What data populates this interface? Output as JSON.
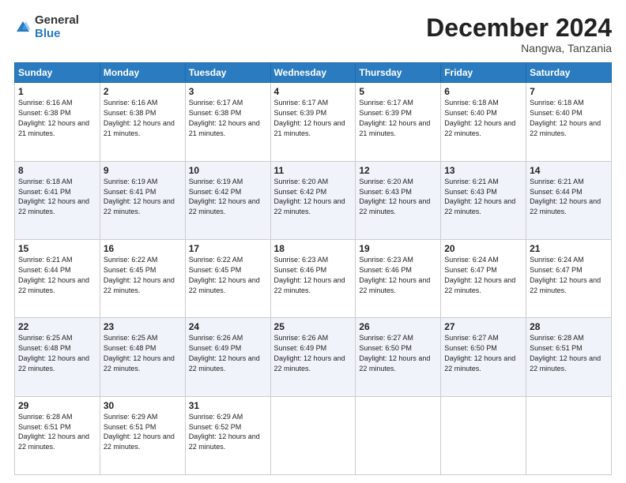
{
  "logo": {
    "general": "General",
    "blue": "Blue"
  },
  "title": "December 2024",
  "subtitle": "Nangwa, Tanzania",
  "days_header": [
    "Sunday",
    "Monday",
    "Tuesday",
    "Wednesday",
    "Thursday",
    "Friday",
    "Saturday"
  ],
  "weeks": [
    [
      {
        "day": "1",
        "sunrise": "6:16 AM",
        "sunset": "6:38 PM",
        "daylight": "12 hours and 21 minutes."
      },
      {
        "day": "2",
        "sunrise": "6:16 AM",
        "sunset": "6:38 PM",
        "daylight": "12 hours and 21 minutes."
      },
      {
        "day": "3",
        "sunrise": "6:17 AM",
        "sunset": "6:38 PM",
        "daylight": "12 hours and 21 minutes."
      },
      {
        "day": "4",
        "sunrise": "6:17 AM",
        "sunset": "6:39 PM",
        "daylight": "12 hours and 21 minutes."
      },
      {
        "day": "5",
        "sunrise": "6:17 AM",
        "sunset": "6:39 PM",
        "daylight": "12 hours and 21 minutes."
      },
      {
        "day": "6",
        "sunrise": "6:18 AM",
        "sunset": "6:40 PM",
        "daylight": "12 hours and 22 minutes."
      },
      {
        "day": "7",
        "sunrise": "6:18 AM",
        "sunset": "6:40 PM",
        "daylight": "12 hours and 22 minutes."
      }
    ],
    [
      {
        "day": "8",
        "sunrise": "6:18 AM",
        "sunset": "6:41 PM",
        "daylight": "12 hours and 22 minutes."
      },
      {
        "day": "9",
        "sunrise": "6:19 AM",
        "sunset": "6:41 PM",
        "daylight": "12 hours and 22 minutes."
      },
      {
        "day": "10",
        "sunrise": "6:19 AM",
        "sunset": "6:42 PM",
        "daylight": "12 hours and 22 minutes."
      },
      {
        "day": "11",
        "sunrise": "6:20 AM",
        "sunset": "6:42 PM",
        "daylight": "12 hours and 22 minutes."
      },
      {
        "day": "12",
        "sunrise": "6:20 AM",
        "sunset": "6:43 PM",
        "daylight": "12 hours and 22 minutes."
      },
      {
        "day": "13",
        "sunrise": "6:21 AM",
        "sunset": "6:43 PM",
        "daylight": "12 hours and 22 minutes."
      },
      {
        "day": "14",
        "sunrise": "6:21 AM",
        "sunset": "6:44 PM",
        "daylight": "12 hours and 22 minutes."
      }
    ],
    [
      {
        "day": "15",
        "sunrise": "6:21 AM",
        "sunset": "6:44 PM",
        "daylight": "12 hours and 22 minutes."
      },
      {
        "day": "16",
        "sunrise": "6:22 AM",
        "sunset": "6:45 PM",
        "daylight": "12 hours and 22 minutes."
      },
      {
        "day": "17",
        "sunrise": "6:22 AM",
        "sunset": "6:45 PM",
        "daylight": "12 hours and 22 minutes."
      },
      {
        "day": "18",
        "sunrise": "6:23 AM",
        "sunset": "6:46 PM",
        "daylight": "12 hours and 22 minutes."
      },
      {
        "day": "19",
        "sunrise": "6:23 AM",
        "sunset": "6:46 PM",
        "daylight": "12 hours and 22 minutes."
      },
      {
        "day": "20",
        "sunrise": "6:24 AM",
        "sunset": "6:47 PM",
        "daylight": "12 hours and 22 minutes."
      },
      {
        "day": "21",
        "sunrise": "6:24 AM",
        "sunset": "6:47 PM",
        "daylight": "12 hours and 22 minutes."
      }
    ],
    [
      {
        "day": "22",
        "sunrise": "6:25 AM",
        "sunset": "6:48 PM",
        "daylight": "12 hours and 22 minutes."
      },
      {
        "day": "23",
        "sunrise": "6:25 AM",
        "sunset": "6:48 PM",
        "daylight": "12 hours and 22 minutes."
      },
      {
        "day": "24",
        "sunrise": "6:26 AM",
        "sunset": "6:49 PM",
        "daylight": "12 hours and 22 minutes."
      },
      {
        "day": "25",
        "sunrise": "6:26 AM",
        "sunset": "6:49 PM",
        "daylight": "12 hours and 22 minutes."
      },
      {
        "day": "26",
        "sunrise": "6:27 AM",
        "sunset": "6:50 PM",
        "daylight": "12 hours and 22 minutes."
      },
      {
        "day": "27",
        "sunrise": "6:27 AM",
        "sunset": "6:50 PM",
        "daylight": "12 hours and 22 minutes."
      },
      {
        "day": "28",
        "sunrise": "6:28 AM",
        "sunset": "6:51 PM",
        "daylight": "12 hours and 22 minutes."
      }
    ],
    [
      {
        "day": "29",
        "sunrise": "6:28 AM",
        "sunset": "6:51 PM",
        "daylight": "12 hours and 22 minutes."
      },
      {
        "day": "30",
        "sunrise": "6:29 AM",
        "sunset": "6:51 PM",
        "daylight": "12 hours and 22 minutes."
      },
      {
        "day": "31",
        "sunrise": "6:29 AM",
        "sunset": "6:52 PM",
        "daylight": "12 hours and 22 minutes."
      },
      null,
      null,
      null,
      null
    ]
  ]
}
